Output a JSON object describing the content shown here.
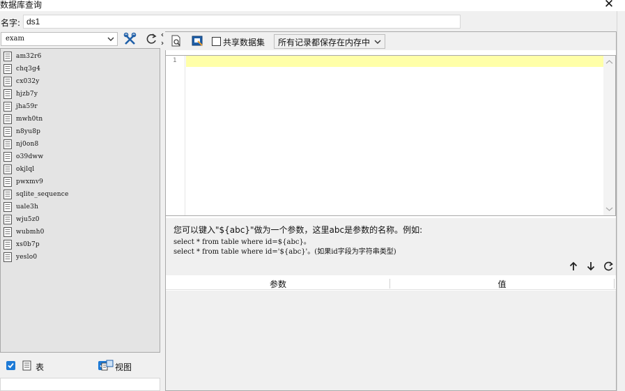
{
  "window": {
    "title": "数据库查询",
    "close_glyph": "✕"
  },
  "name_field": {
    "label": "名字:",
    "value": "ds1"
  },
  "left_panel": {
    "database": "exam",
    "tables": [
      "am32r6",
      "chq3g4",
      "cx032y",
      "hjzb7y",
      "jha59r",
      "mwh0tn",
      "n8yu8p",
      "nj0on8",
      "o39dww",
      "okjlql",
      "pwxmv9",
      "sqlite_sequence",
      "uale3h",
      "wju5z0",
      "wubmh0",
      "xs0b7p",
      "yeslo0"
    ],
    "filter_table_label": "表",
    "filter_view_label": "视图",
    "filter_table_checked": true,
    "filter_view_checked": true,
    "search_value": ""
  },
  "toolbar": {
    "share_label": "共享数据集",
    "share_checked": false,
    "mode_value": "所有记录都保存在内存中"
  },
  "editor": {
    "line_number": "1",
    "content": "",
    "current_line_color": "#ffffa8"
  },
  "hint": {
    "line1": "您可以键入\"${abc}\"做为一个参数，这里abc是参数的名称。例如:",
    "line2": "select * from table where id=${abc}。",
    "line3": "select * from table where id='${abc}'。(如果id字段为字符串类型)"
  },
  "params_table": {
    "columns": [
      "参数",
      "值"
    ],
    "rows": []
  },
  "icons": {
    "tools": "tools-icon",
    "refresh": "refresh-icon",
    "preview": "preview-icon",
    "design": "design-icon",
    "up": "arrow-up-icon",
    "down": "arrow-down-icon"
  },
  "colors": {
    "accent": "#1d7ad6",
    "tree_bg": "#e4e4e4"
  }
}
